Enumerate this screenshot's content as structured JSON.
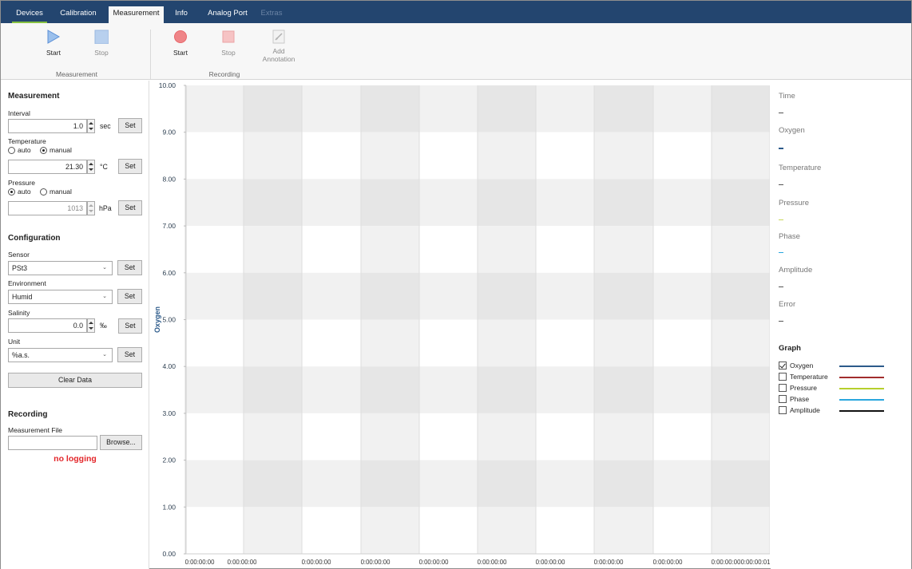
{
  "tabs": [
    {
      "label": "Devices",
      "state": "normal"
    },
    {
      "label": "Calibration",
      "state": "normal"
    },
    {
      "label": "Measurement",
      "state": "active"
    },
    {
      "label": "Info",
      "state": "normal"
    },
    {
      "label": "Analog Port",
      "state": "normal"
    },
    {
      "label": "Extras",
      "state": "disabled"
    }
  ],
  "ribbon": {
    "measurement_group": {
      "start_label": "Start",
      "stop_label": "Stop",
      "group_label": "Measurement"
    },
    "recording_group": {
      "start_label": "Start",
      "stop_label": "Stop",
      "annotation_label_1": "Add",
      "annotation_label_2": "Annotation",
      "group_label": "Recording"
    }
  },
  "measurement": {
    "title": "Measurement",
    "interval_label": "Interval",
    "interval_value": "1.0",
    "interval_unit": "sec",
    "temperature_label": "Temperature",
    "temp_auto": "auto",
    "temp_manual": "manual",
    "temperature_value": "21.30",
    "temperature_unit": "°C",
    "pressure_label": "Pressure",
    "press_auto": "auto",
    "press_manual": "manual",
    "pressure_value": "1013",
    "pressure_unit": "hPa",
    "set_label": "Set"
  },
  "configuration": {
    "title": "Configuration",
    "sensor_label": "Sensor",
    "sensor_value": "PSt3",
    "environment_label": "Environment",
    "environment_value": "Humid",
    "salinity_label": "Salinity",
    "salinity_value": "0.0",
    "salinity_unit": "‰",
    "unit_label": "Unit",
    "unit_value": "%a.s.",
    "set_label": "Set",
    "clear_label": "Clear Data"
  },
  "recording": {
    "title": "Recording",
    "file_label": "Measurement File",
    "file_value": "",
    "browse_label": "Browse...",
    "status": "no logging"
  },
  "readouts": {
    "time_label": "Time",
    "oxygen_label": "Oxygen",
    "temperature_label": "Temperature",
    "pressure_label": "Pressure",
    "phase_label": "Phase",
    "amplitude_label": "Amplitude",
    "error_label": "Error"
  },
  "graph": {
    "title": "Graph",
    "series": [
      {
        "name": "Oxygen",
        "checked": true,
        "color": "#2c5a8a"
      },
      {
        "name": "Temperature",
        "checked": false,
        "color": "#a12d2d"
      },
      {
        "name": "Pressure",
        "checked": false,
        "color": "#b6cf2c"
      },
      {
        "name": "Phase",
        "checked": false,
        "color": "#2aa7de"
      },
      {
        "name": "Amplitude",
        "checked": false,
        "color": "#111111"
      }
    ]
  },
  "colors": {
    "ribbon_tab_bar": "#23456f",
    "accent_green": "#86c140",
    "play_blue": "#5b8fd6",
    "record_red": "#e8686c",
    "no_logging_red": "#e3262a",
    "axis_label_blue": "#2c5a8a"
  },
  "chart_data": {
    "type": "line",
    "ylabel": "Oxygen",
    "ylim": [
      0,
      10
    ],
    "y_ticks": [
      "10.00",
      "9.00",
      "8.00",
      "7.00",
      "6.00",
      "5.00",
      "4.00",
      "3.00",
      "2.00",
      "1.00",
      "0.00"
    ],
    "x_ticks": [
      "0:00:00:00",
      "0:00:00:00",
      "0:00:00:00",
      "0:00:00:00",
      "0:00:00:00",
      "0:00:00:00",
      "0:00:00:00",
      "0:00:00:00",
      "0:00:00:00",
      "0:00:00:00",
      "0:00:00:01"
    ],
    "series": [
      {
        "name": "Oxygen",
        "values": []
      }
    ],
    "grid": true,
    "empty": true
  }
}
